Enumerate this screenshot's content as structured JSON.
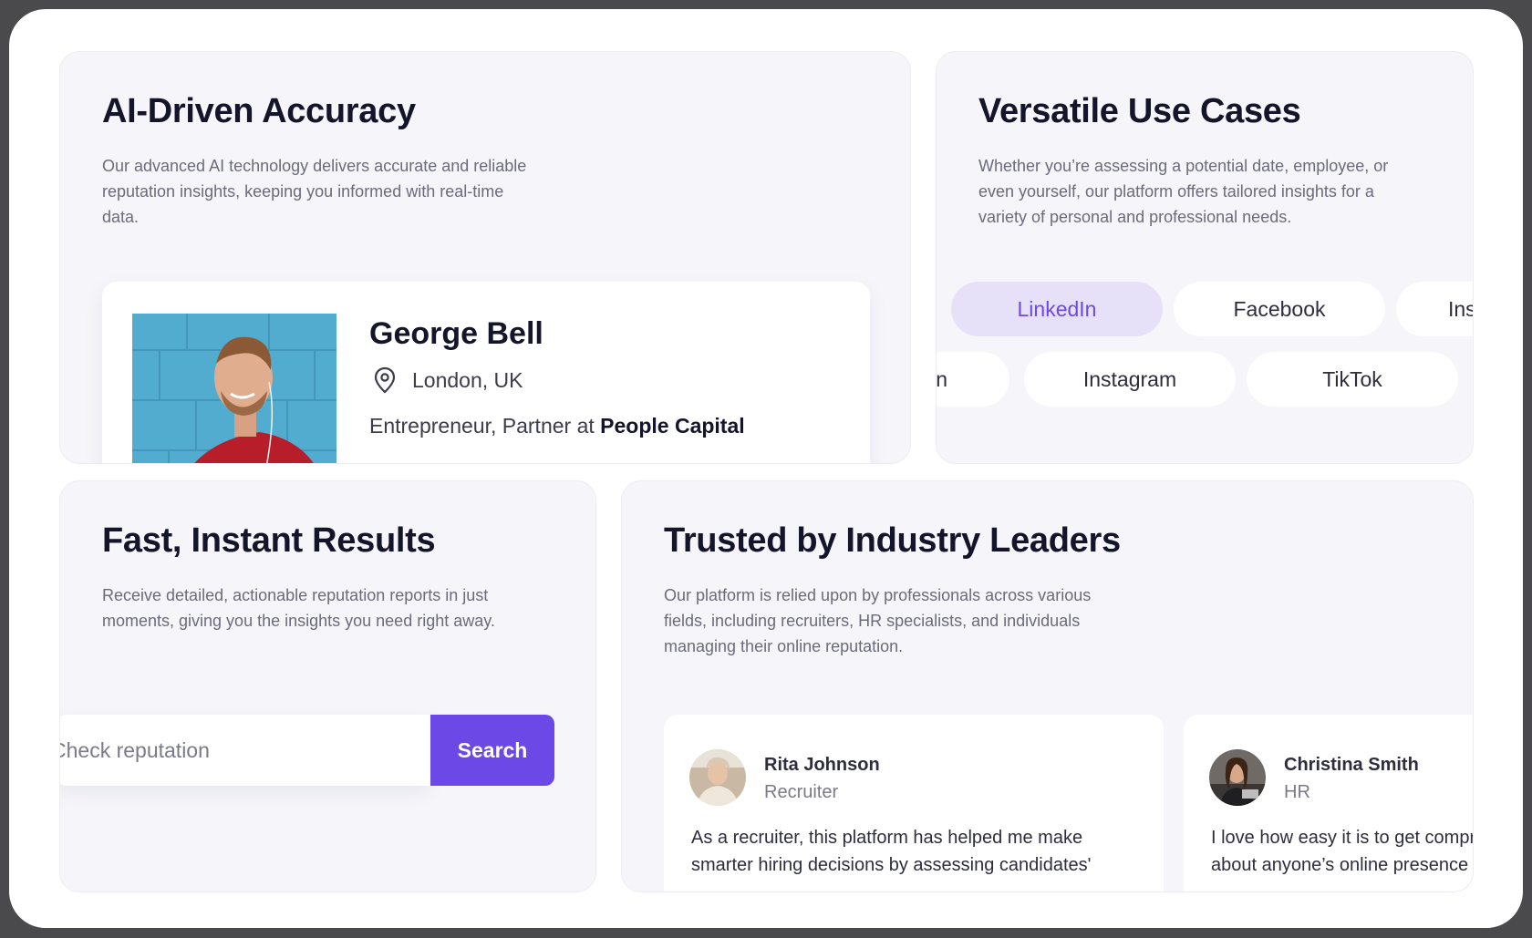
{
  "cards": {
    "ai": {
      "title": "AI-Driven Accuracy",
      "desc": "Our advanced AI technology delivers accurate and reliable reputation insights, keeping you informed with real-time data.",
      "profile": {
        "name": "George Bell",
        "location": "London, UK",
        "role_prefix": "Entrepreneur, Partner at ",
        "company": "People Capital"
      }
    },
    "uses": {
      "title": "Versatile Use Cases",
      "desc": "Whether you’re assessing a potential date, employee, or even yourself, our platform offers tailored insights for a variety of personal and professional needs.",
      "row1": [
        "LinkedIn",
        "Facebook",
        "Instagram"
      ],
      "row2": [
        "LinkedIn",
        "Instagram",
        "TikTok"
      ],
      "active": "LinkedIn"
    },
    "fast": {
      "title": "Fast, Instant Results",
      "desc": "Receive detailed, actionable reputation reports in just moments, giving you the insights you need right away.",
      "search_placeholder": "Check reputation",
      "search_button": "Search"
    },
    "trust": {
      "title": "Trusted by Industry Leaders",
      "desc": "Our platform is relied upon by professionals across various fields, including recruiters, HR specialists, and individuals managing their online reputation.",
      "reviews": [
        {
          "name": "Rita Johnson",
          "role": "Recruiter",
          "text_line1": "As a recruiter, this platform has helped me make",
          "text_line2": "smarter hiring decisions by assessing candidates'"
        },
        {
          "name": "Christina Smith",
          "role": "HR",
          "text_line1": "I love how easy it is to get comprehensive insights",
          "text_line2": "about anyone’s online presence"
        }
      ]
    }
  },
  "colors": {
    "accent": "#6c48e6",
    "card_bg": "#f5f5fa",
    "frame": "#4a4a4c"
  },
  "icons": [
    "location-pin-icon"
  ]
}
